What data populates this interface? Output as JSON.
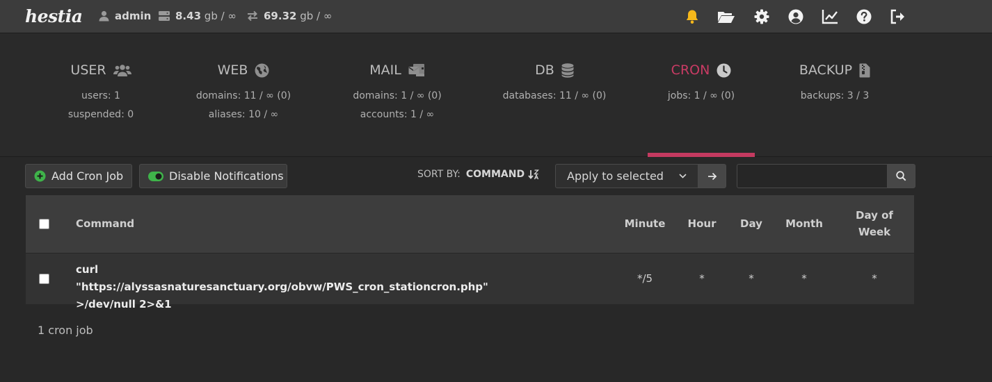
{
  "app": {
    "logo_text": "hestia"
  },
  "topbar": {
    "user": "admin",
    "disk_value": "8.43",
    "disk_unit": "gb / ∞",
    "bandwidth_value": "69.32",
    "bandwidth_unit": "gb / ∞",
    "icons": [
      "bell-icon",
      "folder-icon",
      "gear-icon",
      "user-circle-icon",
      "chart-line-icon",
      "help-icon",
      "logout-icon"
    ],
    "bell_color": "#f6b81b"
  },
  "overview": {
    "user": {
      "title": "USER",
      "line1": "users: 1",
      "line2": "suspended: 0"
    },
    "web": {
      "title": "WEB",
      "line1": "domains: 11 / ∞ (0)",
      "line2": "aliases: 10 / ∞"
    },
    "mail": {
      "title": "MAIL",
      "line1": "domains: 1 / ∞ (0)",
      "line2": "accounts: 1 / ∞"
    },
    "db": {
      "title": "DB",
      "line1": "databases: 11 / ∞ (0)"
    },
    "cron": {
      "title": "CRON",
      "line1": "jobs: 1 / ∞ (0)"
    },
    "backup": {
      "title": "BACKUP",
      "line1": "backups: 3 / 3"
    },
    "active_tab": "CRON",
    "accent_color": "#c93b64"
  },
  "toolbar": {
    "add_label": "Add Cron Job",
    "notifications_label": "Disable Notifications",
    "sort_label": "SORT BY:",
    "sort_value": "COMMAND",
    "bulk_action": "Apply to selected",
    "search_value": ""
  },
  "table": {
    "headers": {
      "command": "Command",
      "minute": "Minute",
      "hour": "Hour",
      "day": "Day",
      "month": "Month",
      "dow": "Day of Week"
    },
    "rows": [
      {
        "command": "curl \"https://alyssasnaturesanctuary.org/obvw/PWS_cron_stationcron.php\" >/dev/null 2>&1",
        "minute": "*/5",
        "hour": "*",
        "day": "*",
        "month": "*",
        "dow": "*"
      }
    ]
  },
  "footer": {
    "count_text": "1 cron job"
  }
}
